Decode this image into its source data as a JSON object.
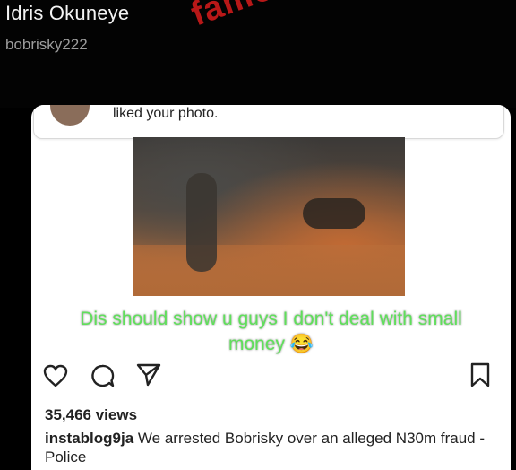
{
  "profile": {
    "name": "Idris Okuneye",
    "handle": "bobrisky222"
  },
  "watermark": "famous",
  "notification": {
    "text": "liked your photo."
  },
  "overlay_caption": {
    "line1": "Dis should show u guys I don't deal with small",
    "line2": "money 😂"
  },
  "post": {
    "views": "35,466 views",
    "username": "instablog9ja",
    "caption": "We arrested Bobrisky over an alleged N30m fraud - Police"
  },
  "icons": [
    "heart-icon",
    "comment-icon",
    "share-icon",
    "bookmark-icon"
  ],
  "colors": {
    "watermark": "#b81818",
    "caption_green": "#5fe05a",
    "background": "#000000"
  }
}
